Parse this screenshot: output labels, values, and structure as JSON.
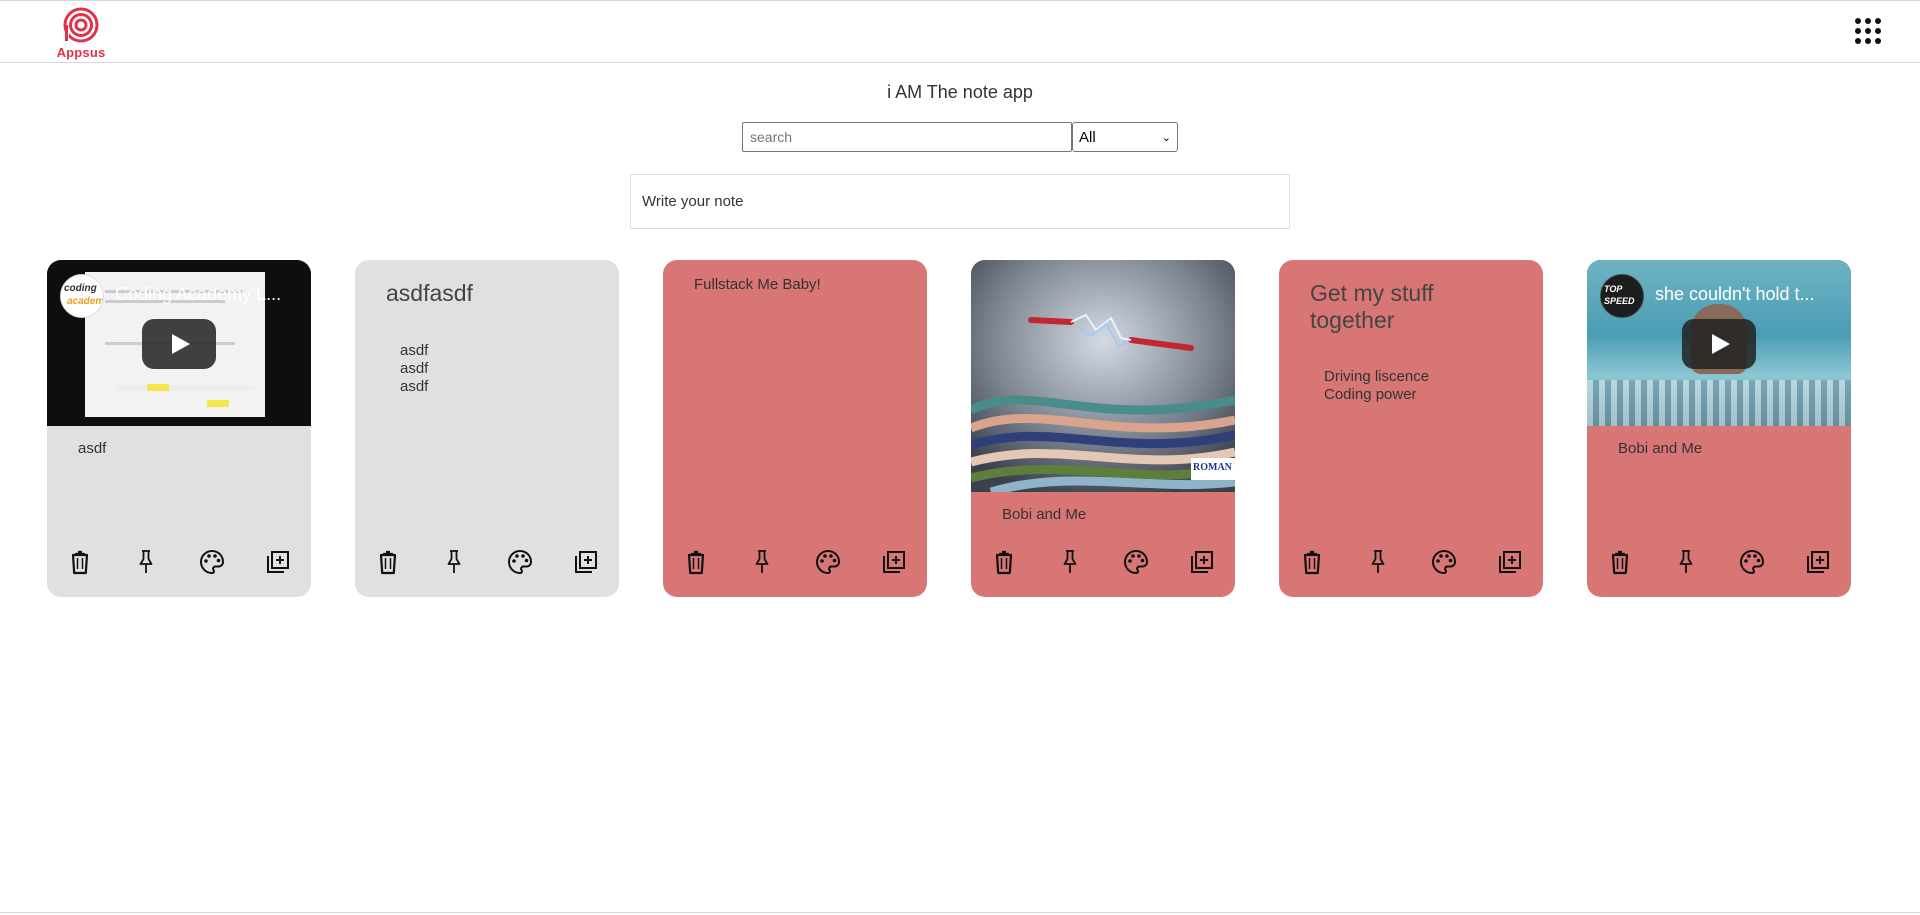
{
  "app": {
    "logo_text": "Appsus"
  },
  "header": {
    "apps_menu_icon": "grid-icon"
  },
  "main": {
    "title": "i AM The note app",
    "search": {
      "placeholder": "search",
      "value": ""
    },
    "filter": {
      "selected": "All"
    },
    "note_input": {
      "placeholder": "Write your note"
    }
  },
  "colors": {
    "gray_card": "#e0e0e0",
    "red_card": "#d87676",
    "logo": "#e0324b"
  },
  "notes": [
    {
      "type": "video",
      "color": "gray",
      "video_title": "Coding Academy L...",
      "channel": "coding academy",
      "text": "asdf"
    },
    {
      "type": "todos",
      "color": "gray",
      "title": "asdfasdf",
      "todos": [
        "asdf",
        "asdf",
        "asdf"
      ]
    },
    {
      "type": "text",
      "color": "red",
      "text": "Fullstack Me Baby!"
    },
    {
      "type": "image",
      "color": "red",
      "image_caption": "ROMAN E",
      "text": "Bobi and Me"
    },
    {
      "type": "todos",
      "color": "red",
      "title": "Get my stuff together",
      "todos": [
        "Driving liscence",
        "Coding power"
      ]
    },
    {
      "type": "video",
      "color": "red",
      "video_title": "she couldn't hold t...",
      "channel": "TOP SPEED",
      "text": "Bobi and Me"
    }
  ],
  "card_actions": [
    "trash-icon",
    "pin-icon",
    "palette-icon",
    "duplicate-icon"
  ]
}
